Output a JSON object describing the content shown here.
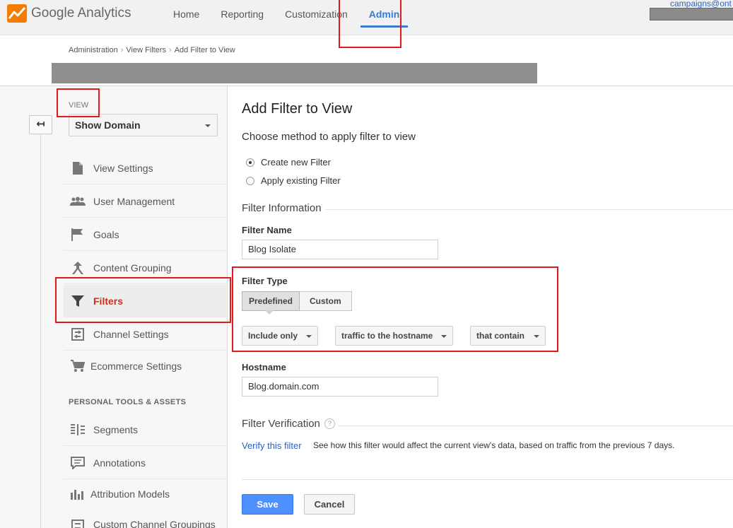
{
  "topbar": {
    "logo_text": "Google Analytics",
    "nav": [
      "Home",
      "Reporting",
      "Customization",
      "Admin"
    ],
    "active_nav": "Admin",
    "account_link": "campaigns@ont"
  },
  "breadcrumb": [
    "Administration",
    "View Filters",
    "Add Filter to View"
  ],
  "sidebar": {
    "view_label": "VIEW",
    "view_value": "Show Domain",
    "items": [
      {
        "label": "View Settings",
        "icon": "document-icon"
      },
      {
        "label": "User Management",
        "icon": "users-icon"
      },
      {
        "label": "Goals",
        "icon": "flag-icon"
      },
      {
        "label": "Content Grouping",
        "icon": "content-grouping-icon"
      },
      {
        "label": "Filters",
        "icon": "funnel-icon",
        "active": true
      },
      {
        "label": "Channel Settings",
        "icon": "channel-settings-icon"
      },
      {
        "label": "Ecommerce Settings",
        "icon": "cart-icon"
      }
    ],
    "section_header": "PERSONAL TOOLS & ASSETS",
    "tools": [
      {
        "label": "Segments",
        "icon": "segments-icon"
      },
      {
        "label": "Annotations",
        "icon": "annotations-icon"
      },
      {
        "label": "Attribution Models",
        "icon": "bar-chart-icon"
      },
      {
        "label": "Custom Channel Groupings",
        "icon": "channel-groupings-icon"
      }
    ]
  },
  "main": {
    "title": "Add Filter to View",
    "subtitle": "Choose method to apply filter to view",
    "methods": [
      "Create new Filter",
      "Apply existing Filter"
    ],
    "selected_method": "Create new Filter",
    "filter_info_heading": "Filter Information",
    "filter_name_label": "Filter Name",
    "filter_name_value": "Blog Isolate",
    "filter_type_label": "Filter Type",
    "filter_type_options": [
      "Predefined",
      "Custom"
    ],
    "filter_type_selected": "Predefined",
    "dropdown_1": "Include only",
    "dropdown_2": "traffic to the hostname",
    "dropdown_3": "that contain",
    "hostname_label": "Hostname",
    "hostname_value": "Blog.domain.com",
    "verification_heading": "Filter Verification",
    "help_glyph": "?",
    "verify_link": "Verify this filter",
    "verify_desc": "See how this filter would affect the current view's data, based on traffic from the previous 7 days.",
    "save_label": "Save",
    "cancel_label": "Cancel"
  },
  "colors": {
    "accent_blue": "#4d90fe",
    "link_blue": "#2a62c1",
    "active_red": "#c1351f",
    "annotation_red": "#e0191c",
    "logo_orange": "#f57c00"
  }
}
